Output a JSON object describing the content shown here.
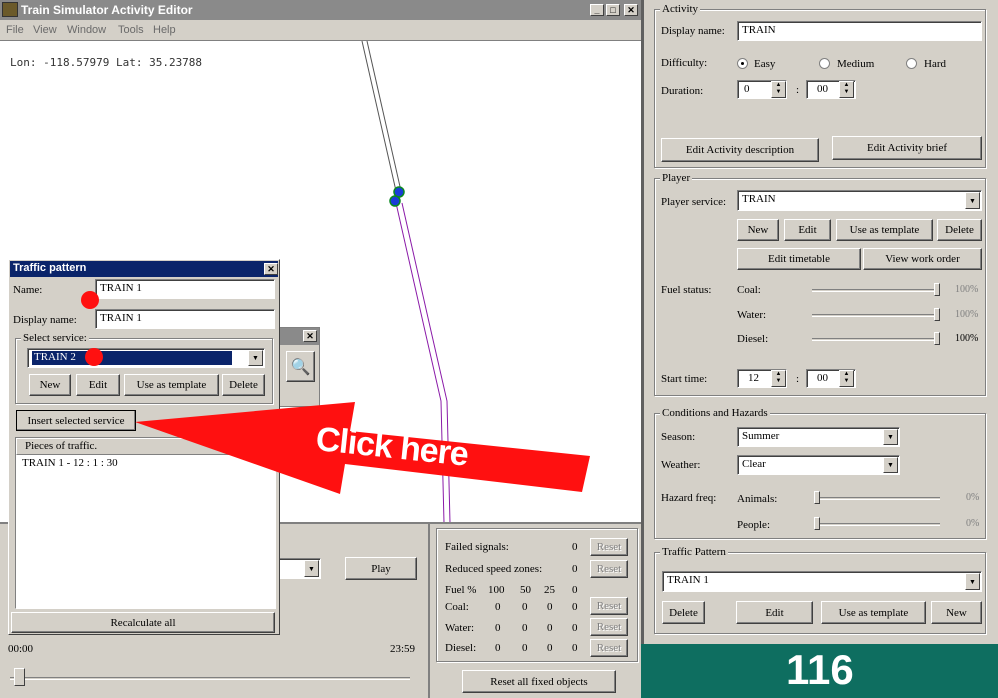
{
  "window": {
    "title": "Train Simulator Activity Editor"
  },
  "menu": [
    "File",
    "View",
    "Window",
    "Tools",
    "Help"
  ],
  "map": {
    "coords": "Lon: -118.57979 Lat: 35.23788"
  },
  "traffic_dialog": {
    "title": "Traffic pattern",
    "name_label": "Name:",
    "name_value": "TRAIN 1",
    "display_label": "Display name:",
    "display_value": "TRAIN 1",
    "select_group": "Select service:",
    "service_value": "TRAIN 2",
    "btn_new": "New",
    "btn_edit": "Edit",
    "btn_template": "Use as template",
    "btn_delete": "Delete",
    "btn_insert": "Insert selected service",
    "pieces_header": "Pieces of traffic.",
    "pieces": [
      "TRAIN 1 - 12 : 1 : 30"
    ],
    "btn_recalc": "Recalculate all"
  },
  "playback": {
    "play": "Play",
    "start": "00:00",
    "end": "23:59"
  },
  "stats": {
    "failed_signals": "Failed signals:",
    "failed_val": "0",
    "reduced_speed": "Reduced speed zones:",
    "reduced_val": "0",
    "reset": "Reset",
    "fuel_row": [
      "Fuel %",
      "100",
      "50",
      "25",
      "0"
    ],
    "coal_row": [
      "Coal:",
      "0",
      "0",
      "0",
      "0"
    ],
    "water_row": [
      "Water:",
      "0",
      "0",
      "0",
      "0"
    ],
    "diesel_row": [
      "Diesel:",
      "0",
      "0",
      "0",
      "0"
    ],
    "reset_all": "Reset all fixed objects"
  },
  "activity": {
    "group": "Activity",
    "display_label": "Display name:",
    "display_value": "TRAIN",
    "difficulty_label": "Difficulty:",
    "easy": "Easy",
    "medium": "Medium",
    "hard": "Hard",
    "duration_label": "Duration:",
    "dur_h": "0",
    "dur_m": "00",
    "colon": ":",
    "btn_desc": "Edit Activity description",
    "btn_brief": "Edit Activity brief"
  },
  "player": {
    "group": "Player",
    "service_label": "Player service:",
    "service_value": "TRAIN",
    "btn_new": "New",
    "btn_edit": "Edit",
    "btn_template": "Use as template",
    "btn_delete": "Delete",
    "btn_timetable": "Edit timetable",
    "btn_workorder": "View work order",
    "fuel_label": "Fuel status:",
    "coal": "Coal:",
    "water": "Water:",
    "diesel": "Diesel:",
    "pct": "100%",
    "start_label": "Start time:",
    "start_h": "12",
    "start_m": "00"
  },
  "conditions": {
    "group": "Conditions and Hazards",
    "season_label": "Season:",
    "season_value": "Summer",
    "weather_label": "Weather:",
    "weather_value": "Clear",
    "hazard_label": "Hazard freq:",
    "animals": "Animals:",
    "people": "People:",
    "pct": "0%"
  },
  "traffic_pattern": {
    "group": "Traffic Pattern",
    "value": "TRAIN 1",
    "btn_delete": "Delete",
    "btn_edit": "Edit",
    "btn_template": "Use as template",
    "btn_new": "New"
  },
  "annotation": {
    "text": "Click here",
    "number": "116"
  }
}
